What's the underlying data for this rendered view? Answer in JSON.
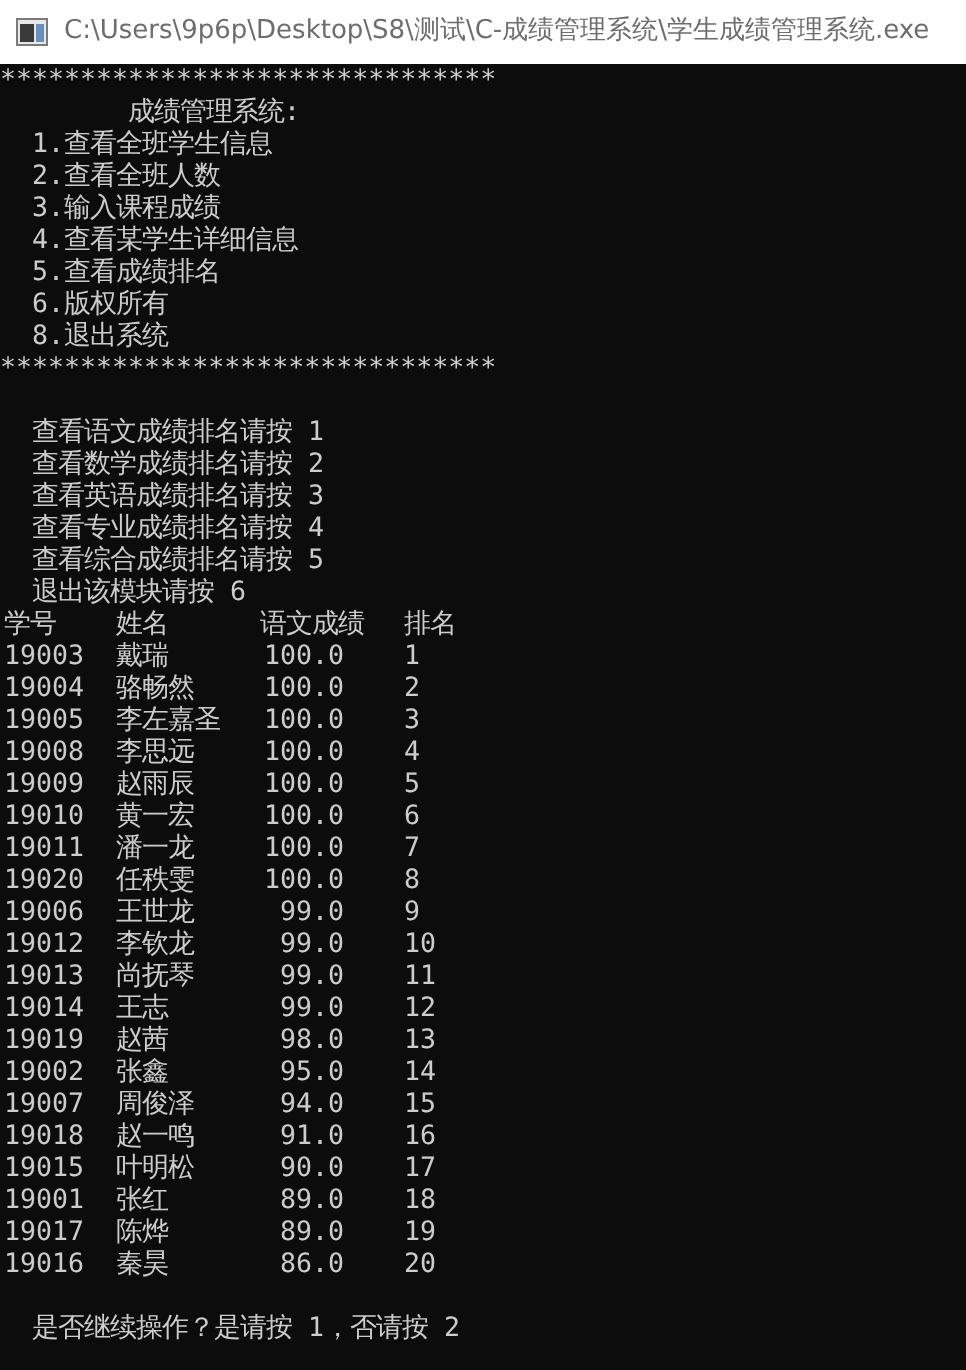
{
  "window": {
    "title": "C:\\Users\\9p6p\\Desktop\\S8\\测试\\C-成绩管理系统\\学生成绩管理系统.exe"
  },
  "console": {
    "banner_top": "*******************************",
    "menu_title": "成绩管理系统:",
    "menu_items": [
      "1.查看全班学生信息",
      "2.查看全班人数",
      "3.输入课程成绩",
      "4.查看某学生详细信息",
      "5.查看成绩排名",
      "6.版权所有",
      "8.退出系统"
    ],
    "banner_bottom": "*******************************",
    "submenu_items": [
      "查看语文成绩排名请按 1",
      "查看数学成绩排名请按 2",
      "查看英语成绩排名请按 3",
      "查看专业成绩排名请按 4",
      "查看综合成绩排名请按 5",
      "退出该模块请按 6"
    ],
    "table": {
      "columns": [
        "学号",
        "姓名",
        "语文成绩",
        "排名"
      ],
      "rows": [
        [
          "19003",
          "戴瑞",
          "100.0",
          "1"
        ],
        [
          "19004",
          "骆畅然",
          "100.0",
          "2"
        ],
        [
          "19005",
          "李左嘉圣",
          "100.0",
          "3"
        ],
        [
          "19008",
          "李思远",
          "100.0",
          "4"
        ],
        [
          "19009",
          "赵雨辰",
          "100.0",
          "5"
        ],
        [
          "19010",
          "黄一宏",
          "100.0",
          "6"
        ],
        [
          "19011",
          "潘一龙",
          "100.0",
          "7"
        ],
        [
          "19020",
          "任秩雯",
          "100.0",
          "8"
        ],
        [
          "19006",
          "王世龙",
          "99.0",
          "9"
        ],
        [
          "19012",
          "李钦龙",
          "99.0",
          "10"
        ],
        [
          "19013",
          "尚抚琴",
          "99.0",
          "11"
        ],
        [
          "19014",
          "王志",
          "99.0",
          "12"
        ],
        [
          "19019",
          "赵茜",
          "98.0",
          "13"
        ],
        [
          "19002",
          "张鑫",
          "95.0",
          "14"
        ],
        [
          "19007",
          "周俊泽",
          "94.0",
          "15"
        ],
        [
          "19018",
          "赵一鸣",
          "91.0",
          "16"
        ],
        [
          "19015",
          "叶明松",
          "90.0",
          "17"
        ],
        [
          "19001",
          "张红",
          "89.0",
          "18"
        ],
        [
          "19017",
          "陈烨",
          "89.0",
          "19"
        ],
        [
          "19016",
          "秦昊",
          "86.0",
          "20"
        ]
      ]
    },
    "prompt": "是否继续操作？是请按 1，否请按 2"
  }
}
